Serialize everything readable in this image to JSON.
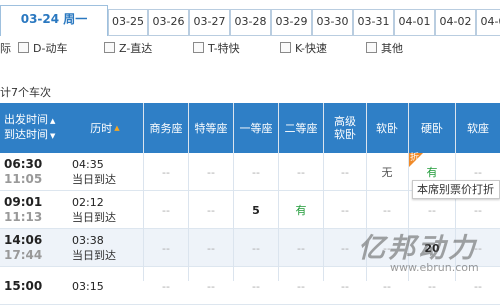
{
  "tabs": [
    {
      "label": "03-24 周一",
      "active": true
    },
    {
      "label": "03-25"
    },
    {
      "label": "03-26"
    },
    {
      "label": "03-27"
    },
    {
      "label": "03-28"
    },
    {
      "label": "03-29"
    },
    {
      "label": "03-30"
    },
    {
      "label": "03-31"
    },
    {
      "label": "04-01"
    },
    {
      "label": "04-02"
    },
    {
      "label": "04-03"
    }
  ],
  "filters": {
    "partial": "际",
    "options": [
      {
        "label": "D-动车",
        "checked": false
      },
      {
        "label": "Z-直达",
        "checked": false
      },
      {
        "label": "T-特快",
        "checked": false
      },
      {
        "label": "K-快速",
        "checked": false
      },
      {
        "label": "其他",
        "checked": false
      }
    ]
  },
  "summary": "计7个车次",
  "columns": {
    "dep_arr_1": "出发时间",
    "dep_arr_2": "到达时间",
    "duration": "历时",
    "business": "商务座",
    "premium": "特等座",
    "first": "一等座",
    "second": "二等座",
    "soft_sleeper_hi_1": "高级",
    "soft_sleeper_hi_2": "软卧",
    "soft_sleeper": "软卧",
    "hard_sleeper": "硬卧",
    "soft_seat": "软座"
  },
  "rows": [
    {
      "dep": "06:30",
      "arr": "11:05",
      "duration": "04:35",
      "note": "当日到达",
      "seats": [
        "--",
        "--",
        "--",
        "--",
        "--",
        "无",
        "有",
        "--"
      ]
    },
    {
      "dep": "09:01",
      "arr": "11:13",
      "duration": "02:12",
      "note": "当日到达",
      "seats": [
        "--",
        "--",
        "5",
        "有",
        "--",
        "--",
        "--",
        "--"
      ]
    },
    {
      "dep": "14:06",
      "arr": "17:44",
      "duration": "03:38",
      "note": "当日到达",
      "seats": [
        "--",
        "--",
        "--",
        "--",
        "--",
        "--",
        "20",
        "--"
      ]
    },
    {
      "dep": "15:00",
      "arr": "",
      "duration": "03:15",
      "note": "",
      "seats": [
        "--",
        "--",
        "--",
        "--",
        "--",
        "--",
        "--",
        "--"
      ]
    }
  ],
  "discount": {
    "tag": "折",
    "tooltip": "本席别票价打折"
  },
  "watermark": {
    "logo": "亿邦动力",
    "url": "www.ebrun.com"
  },
  "colors": {
    "header_bg": "#2f7fc6",
    "tab_active_text": "#2a78c0",
    "yes": "#1e9a37",
    "discount": "#f08a28"
  }
}
